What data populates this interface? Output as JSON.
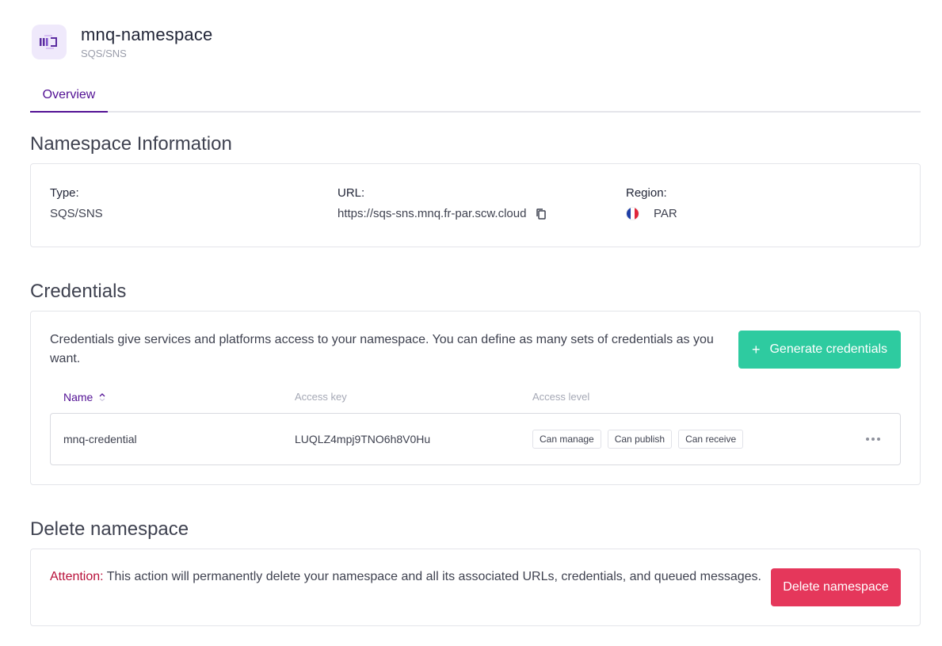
{
  "header": {
    "icon": "queue-icon",
    "title": "mnq-namespace",
    "subtitle": "SQS/SNS"
  },
  "tabs": [
    {
      "label": "Overview",
      "active": true
    }
  ],
  "namespace_info": {
    "title": "Namespace Information",
    "type_label": "Type:",
    "type_value": "SQS/SNS",
    "url_label": "URL:",
    "url_value": "https://sqs-sns.mnq.fr-par.scw.cloud",
    "region_label": "Region:",
    "region_value": "PAR",
    "region_flag": "france-flag-icon"
  },
  "credentials": {
    "title": "Credentials",
    "description": "Credentials give services and platforms access to your namespace. You can define as many sets of credentials as you want.",
    "generate_button": "Generate credentials",
    "columns": {
      "name": "Name",
      "access_key": "Access key",
      "access_level": "Access level"
    },
    "rows": [
      {
        "name": "mnq-credential",
        "access_key": "LUQLZ4mpj9TNO6h8V0Hu",
        "levels": [
          "Can manage",
          "Can publish",
          "Can receive"
        ]
      }
    ]
  },
  "delete": {
    "title": "Delete namespace",
    "attention": "Attention:",
    "message": " This action will permanently delete your namespace and all its associated URLs, credentials, and queued messages.",
    "button": "Delete namespace"
  },
  "colors": {
    "primary": "#521094",
    "success": "#2ecba0",
    "danger": "#e5375b"
  }
}
